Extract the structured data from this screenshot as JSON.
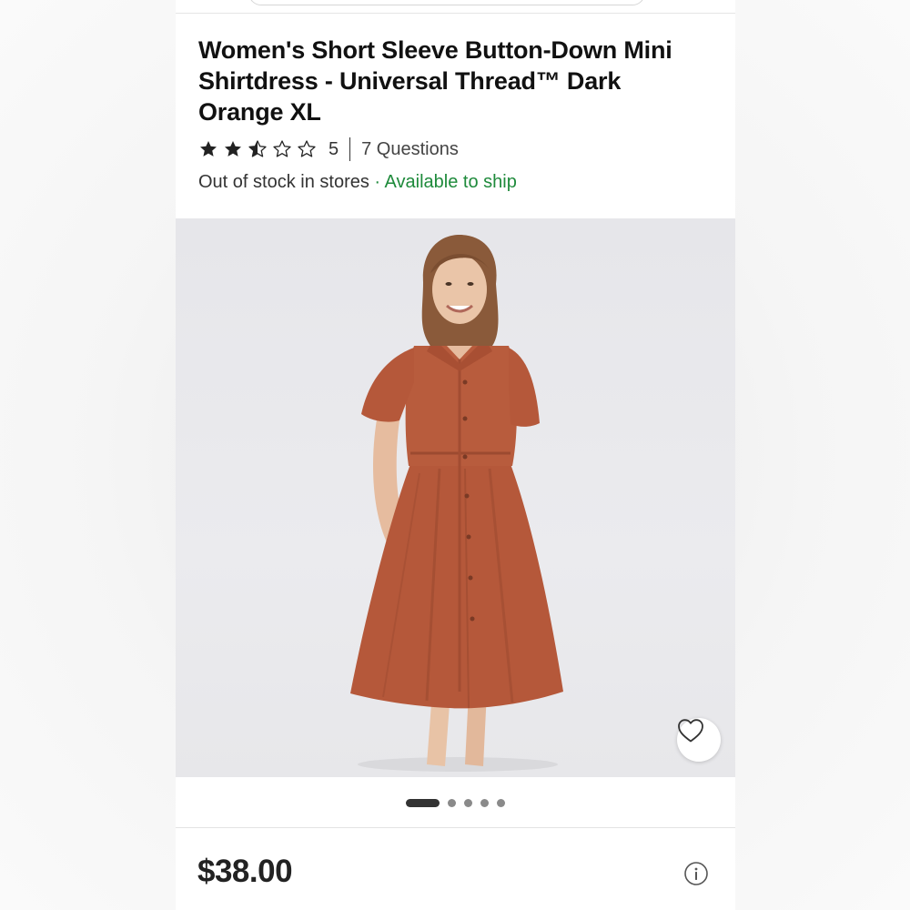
{
  "product": {
    "title": "Women's Short Sleeve Button-Down Mini Shirtdress - Universal Thread™ Dark Orange XL",
    "rating_value": 2.5,
    "rating_max": 5,
    "rating_count": "5",
    "questions_link": "7 Questions",
    "stock_status": "Out of stock in stores",
    "availability_separator": "·",
    "ship_status": "Available to ship",
    "price": "$38.00"
  },
  "image": {
    "icon": "product-photo",
    "dress_color": "#b5583a",
    "background_color": "#e8e8eb"
  },
  "carousel": {
    "total": 5,
    "active_index": 0
  },
  "icons": {
    "favorite": "heart-outline-icon",
    "info": "info-circle-icon",
    "star": "star-icon"
  },
  "colors": {
    "ship_green": "#1e8a3b",
    "text_primary": "#111111",
    "text_secondary": "#333333"
  }
}
